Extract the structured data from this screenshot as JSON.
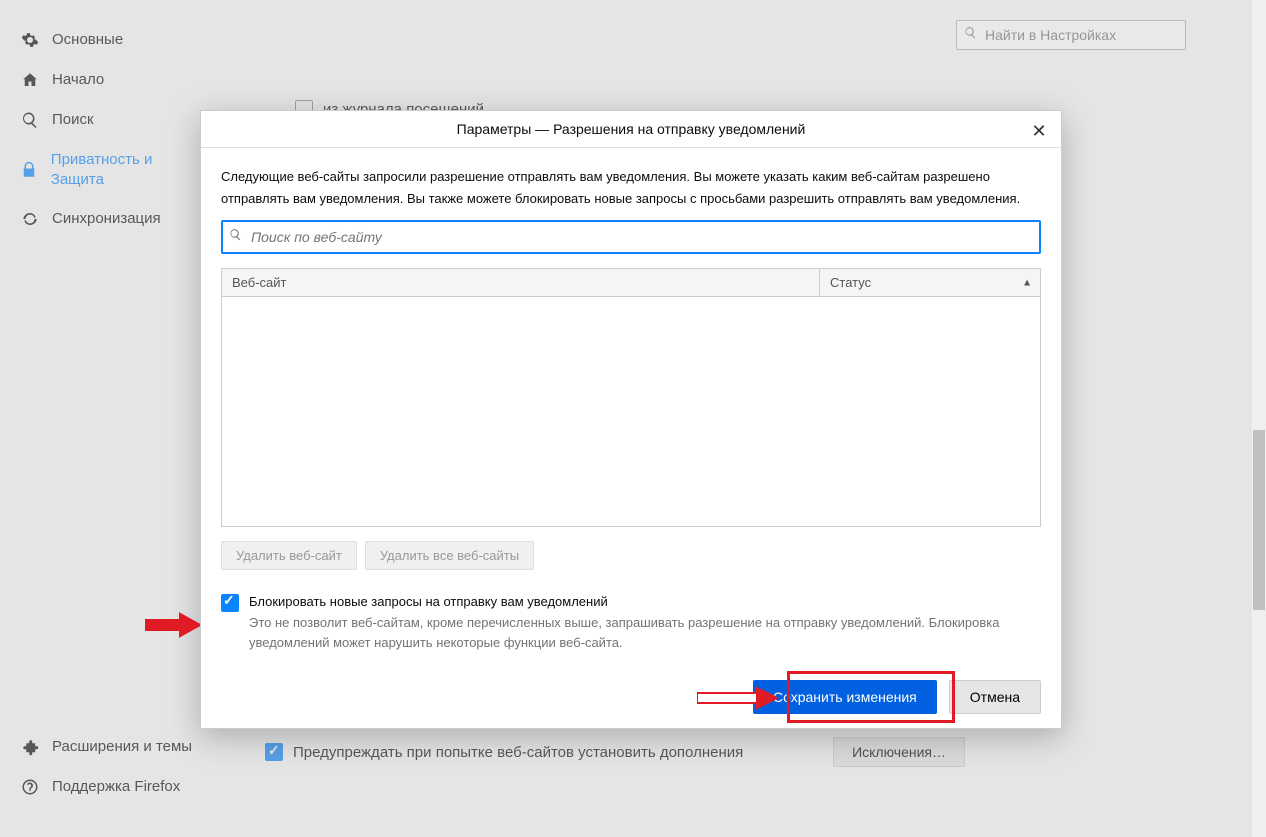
{
  "sidebar": {
    "items": [
      {
        "label": "Основные"
      },
      {
        "label": "Начало"
      },
      {
        "label": "Поиск"
      },
      {
        "label": "Приватность и Защита"
      },
      {
        "label": "Синхронизация"
      }
    ],
    "bottom": [
      {
        "label": "Расширения и темы"
      },
      {
        "label": "Поддержка Firefox"
      }
    ]
  },
  "topSearch": {
    "placeholder": "Найти в Настройках"
  },
  "bg": {
    "historyLabel": "из журнала посещений",
    "warnLabel": "Предупреждать при попытке веб-сайтов установить дополнения",
    "exceptionsBtn": "Исключения…"
  },
  "dialog": {
    "title": "Параметры — Разрешения на отправку уведомлений",
    "description": "Следующие веб-сайты запросили разрешение отправлять вам уведомления. Вы можете указать каким веб-сайтам разрешено отправлять вам уведомления. Вы также можете блокировать новые запросы с просьбами разрешить отправлять вам уведомления.",
    "searchPlaceholder": "Поиск по веб-сайту",
    "thSite": "Веб-сайт",
    "thStatus": "Статус",
    "btnRemove": "Удалить веб-сайт",
    "btnRemoveAll": "Удалить все веб-сайты",
    "blockTitle": "Блокировать новые запросы на отправку вам уведомлений",
    "blockSub": "Это не позволит веб-сайтам, кроме перечисленных выше, запрашивать разрешение на отправку уведомлений. Блокировка уведомлений может нарушить некоторые функции веб-сайта.",
    "btnSave": "Сохранить изменения",
    "btnCancel": "Отмена"
  }
}
